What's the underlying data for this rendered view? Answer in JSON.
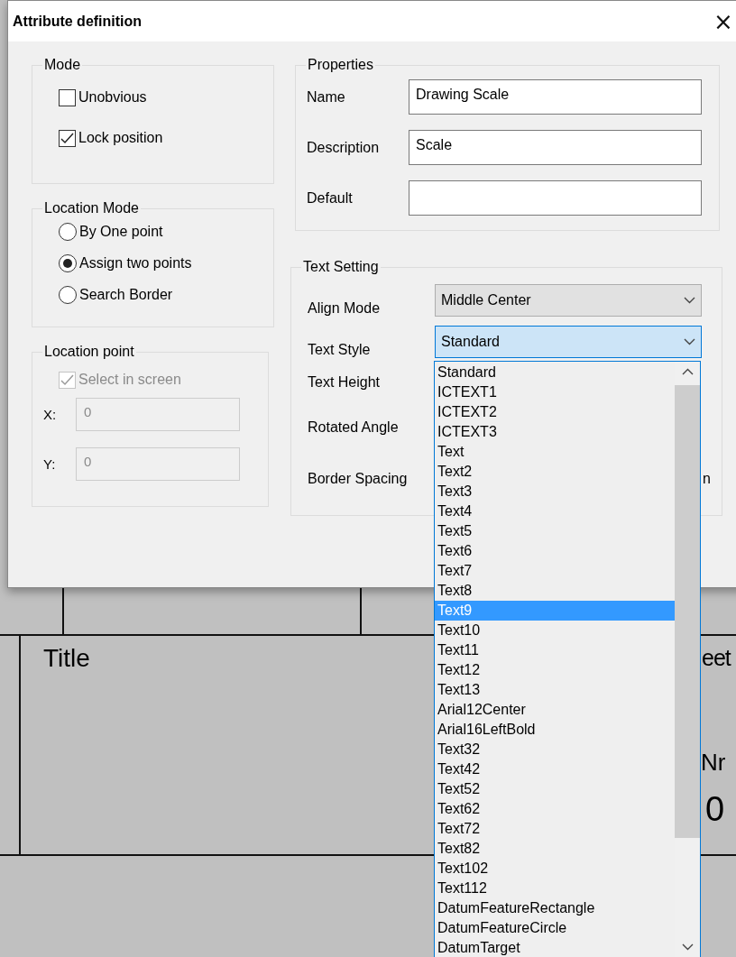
{
  "window": {
    "title": "Attribute definition",
    "close": "×"
  },
  "mode": {
    "title": "Mode",
    "options": [
      {
        "label": "Unobvious",
        "checked": false
      },
      {
        "label": "Lock position",
        "checked": true
      }
    ]
  },
  "location_mode": {
    "title": "Location Mode",
    "options": [
      {
        "label": "By One point",
        "selected": false
      },
      {
        "label": "Assign two points",
        "selected": true
      },
      {
        "label": "Search Border",
        "selected": false
      }
    ]
  },
  "location_point": {
    "title": "Location point",
    "select_in_screen": {
      "label": "Select in screen",
      "checked": true,
      "disabled": true
    },
    "fields": [
      {
        "label": "X:",
        "value": "0",
        "disabled": true
      },
      {
        "label": "Y:",
        "value": "0",
        "disabled": true
      }
    ]
  },
  "properties": {
    "title": "Properties",
    "fields": [
      {
        "label": "Name",
        "value": "Drawing Scale"
      },
      {
        "label": "Description",
        "value": "Scale"
      },
      {
        "label": "Default"
      }
    ]
  },
  "text_setting": {
    "title": "Text Setting",
    "rows": [
      {
        "label": "Align Mode",
        "kind": "select",
        "value": "Middle Center",
        "focused": false
      },
      {
        "label": "Text Style",
        "kind": "select",
        "value": "Standard",
        "focused": true
      },
      {
        "label": "Text Height",
        "kind": "hidden"
      },
      {
        "label": "Rotated Angle",
        "kind": "hidden"
      },
      {
        "label": "Border Spacing",
        "kind": "hidden",
        "trailing": "n"
      }
    ]
  },
  "dropdown": {
    "items": [
      {
        "label": "Standard",
        "selected": false
      },
      {
        "label": "ICTEXT1",
        "selected": false
      },
      {
        "label": "ICTEXT2",
        "selected": false
      },
      {
        "label": "ICTEXT3",
        "selected": false
      },
      {
        "label": "Text",
        "selected": false
      },
      {
        "label": "Text2",
        "selected": false
      },
      {
        "label": "Text3",
        "selected": false
      },
      {
        "label": "Text4",
        "selected": false
      },
      {
        "label": "Text5",
        "selected": false
      },
      {
        "label": "Text6",
        "selected": false
      },
      {
        "label": "Text7",
        "selected": false
      },
      {
        "label": "Text8",
        "selected": false
      },
      {
        "label": "Text9",
        "selected": true
      },
      {
        "label": "Text10",
        "selected": false
      },
      {
        "label": "Text11",
        "selected": false
      },
      {
        "label": "Text12",
        "selected": false
      },
      {
        "label": "Text13",
        "selected": false
      },
      {
        "label": "Arial12Center",
        "selected": false
      },
      {
        "label": "Arial16LeftBold",
        "selected": false
      },
      {
        "label": "Text32",
        "selected": false
      },
      {
        "label": "Text42",
        "selected": false
      },
      {
        "label": "Text52",
        "selected": false
      },
      {
        "label": "Text62",
        "selected": false
      },
      {
        "label": "Text72",
        "selected": false
      },
      {
        "label": "Text82",
        "selected": false
      },
      {
        "label": "Text102",
        "selected": false
      },
      {
        "label": "Text112",
        "selected": false
      },
      {
        "label": "DatumFeatureRectangle",
        "selected": false
      },
      {
        "label": "DatumFeatureCircle",
        "selected": false
      },
      {
        "label": "DatumTarget",
        "selected": false
      }
    ]
  },
  "drawing": {
    "title": "Title",
    "sheet": "eet",
    "number_label": "Nr",
    "number": "0"
  }
}
